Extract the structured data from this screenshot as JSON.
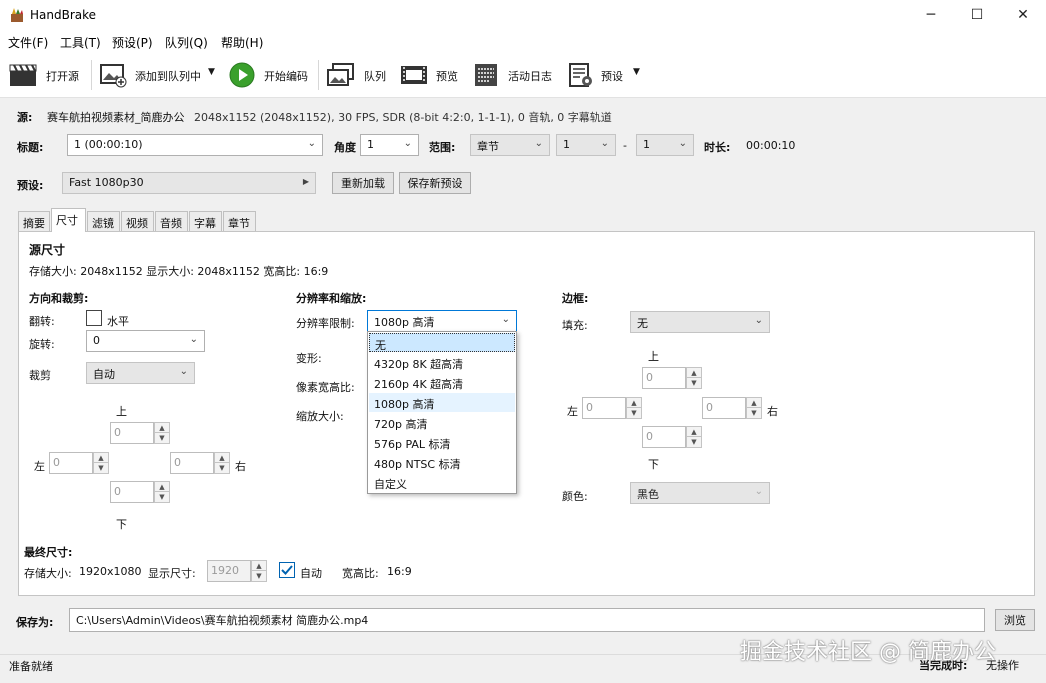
{
  "window": {
    "title": "HandBrake",
    "controls": {
      "minimize": "─",
      "maximize": "☐",
      "close": "✕"
    }
  },
  "menu": [
    "文件(F)",
    "工具(T)",
    "预设(P)",
    "队列(Q)",
    "帮助(H)"
  ],
  "toolbar": {
    "open_source": "打开源",
    "add_to_queue": "添加到队列中",
    "start_encode": "开始编码",
    "queue": "队列",
    "preview": "预览",
    "activity_log": "活动日志",
    "presets": "预设"
  },
  "source": {
    "label": "源:",
    "name": "赛车航拍视频素材_简鹿办公",
    "info": "2048x1152 (2048x1152), 30 FPS, SDR (8-bit 4:2:0, 1-1-1), 0 音轨, 0 字幕轨道"
  },
  "title_row": {
    "title_label": "标题:",
    "title_value": "1  (00:00:10)",
    "angle_label": "角度",
    "angle_value": "1",
    "range_label": "范围:",
    "range_type": "章节",
    "range_start": "1",
    "range_dash": "-",
    "range_end": "1",
    "duration_label": "时长:",
    "duration_value": "00:00:10"
  },
  "preset_row": {
    "label": "预设:",
    "value": "Fast 1080p30",
    "reload": "重新加载",
    "save_new": "保存新预设"
  },
  "tabs": [
    "摘要",
    "尺寸",
    "滤镜",
    "视频",
    "音频",
    "字幕",
    "章节"
  ],
  "active_tab": "尺寸",
  "dimensions": {
    "source_size_header": "源尺寸",
    "source_size_info": "存储大小: 2048x1152  显示大小: 2048x1152  宽高比: 16:9",
    "orientation": {
      "header": "方向和裁剪:",
      "flip_label": "翻转:",
      "flip_option": "水平",
      "rotate_label": "旋转:",
      "rotate_value": "0",
      "crop_label": "裁剪",
      "crop_value": "自动",
      "top": "上",
      "bottom": "下",
      "left": "左",
      "right": "右",
      "top_value": "0",
      "bottom_value": "0",
      "left_value": "0",
      "right_value": "0"
    },
    "resolution": {
      "header": "分辨率和缩放:",
      "limit_label": "分辨率限制:",
      "limit_value": "1080p 高清",
      "anamorphic_label": "变形:",
      "par_label": "像素宽高比:",
      "scale_label": "缩放大小:"
    },
    "dropdown_options": [
      "无",
      "4320p 8K 超高清",
      "2160p 4K 超高清",
      "1080p 高清",
      "720p 高清",
      "576p PAL 标清",
      "480p NTSC 标清",
      "自定义"
    ],
    "borders": {
      "header": "边框:",
      "fill_label": "填充:",
      "fill_value": "无",
      "top": "上",
      "bottom": "下",
      "left": "左",
      "right": "右",
      "top_value": "0",
      "bottom_value": "0",
      "left_value": "0",
      "right_value": "0",
      "color_label": "颜色:",
      "color_value": "黑色"
    },
    "final": {
      "header": "最终尺寸:",
      "storage_label": "存储大小:",
      "storage_value": "1920x1080",
      "display_label": "显示尺寸:",
      "display_value": "1920",
      "auto_label": "自动",
      "aspect_label": "宽高比:",
      "aspect_value": "16:9"
    }
  },
  "save": {
    "label": "保存为:",
    "path": "C:\\Users\\Admin\\Videos\\赛车航拍视频素材 简鹿办公.mp4",
    "browse": "浏览"
  },
  "status": {
    "text": "准备就绪",
    "when_done_label": "当完成时:",
    "when_done_value": "无操作"
  },
  "watermark": "掘金技术社区 @ 简鹿办公",
  "colors": {
    "play_green": "#3aa02c",
    "selection": "#cce8ff",
    "check_blue": "#0063b1"
  }
}
